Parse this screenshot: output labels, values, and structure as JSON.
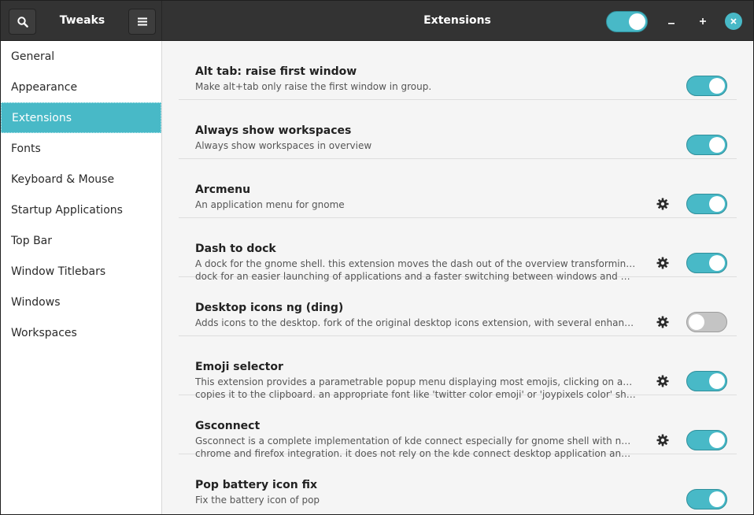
{
  "header": {
    "app_title": "Tweaks",
    "page_title": "Extensions",
    "extensions_enabled": true,
    "search_icon": "search-icon",
    "menu_icon": "hamburger-menu-icon",
    "minimize_label": "–",
    "maximize_label": "+",
    "close_label": "✕"
  },
  "colors": {
    "accent": "#48b9c7",
    "headerbar": "#333333",
    "sidebar_bg": "#ffffff",
    "content_bg": "#f5f5f5",
    "switch_off": "#c4c4c4"
  },
  "sidebar": {
    "active_index": 2,
    "items": [
      {
        "label": "General"
      },
      {
        "label": "Appearance"
      },
      {
        "label": "Extensions"
      },
      {
        "label": "Fonts"
      },
      {
        "label": "Keyboard & Mouse"
      },
      {
        "label": "Startup Applications"
      },
      {
        "label": "Top Bar"
      },
      {
        "label": "Window Titlebars"
      },
      {
        "label": "Windows"
      },
      {
        "label": "Workspaces"
      }
    ]
  },
  "extensions": [
    {
      "name": "Alt tab: raise first window",
      "desc1": "Make alt+tab only raise the first window in group.",
      "desc2": "",
      "has_settings": false,
      "enabled": true
    },
    {
      "name": "Always show workspaces",
      "desc1": "Always show workspaces in overview",
      "desc2": "",
      "has_settings": false,
      "enabled": true
    },
    {
      "name": "Arcmenu",
      "desc1": "An application menu for gnome",
      "desc2": "",
      "has_settings": true,
      "enabled": true
    },
    {
      "name": "Dash to dock",
      "desc1": "A dock for the gnome shell. this extension moves the dash out of the overview transforming it in a",
      "desc2": "dock for an easier launching of applications and a faster switching between windows and desktop...",
      "has_settings": true,
      "enabled": true
    },
    {
      "name": "Desktop icons ng (ding)",
      "desc1": "Adds icons to the desktop. fork of the original desktop icons extension, with several enhancements .",
      "desc2": "",
      "has_settings": true,
      "enabled": false
    },
    {
      "name": "Emoji selector",
      "desc1": "This extension provides a parametrable popup menu displaying most emojis, clicking on an emoji",
      "desc2": "copies it to the clipboard. an appropriate font like 'twitter color emoji' or 'joypixels color' should b...",
      "has_settings": true,
      "enabled": true
    },
    {
      "name": "Gsconnect",
      "desc1": "Gsconnect is a complete implementation of kde connect especially for gnome shell with nautilus,",
      "desc2": "chrome and firefox integration. it does not rely on the kde connect desktop application and will not ...",
      "has_settings": true,
      "enabled": true
    },
    {
      "name": "Pop battery icon fix",
      "desc1": "Fix the battery icon of pop",
      "desc2": "",
      "has_settings": false,
      "enabled": true
    }
  ]
}
